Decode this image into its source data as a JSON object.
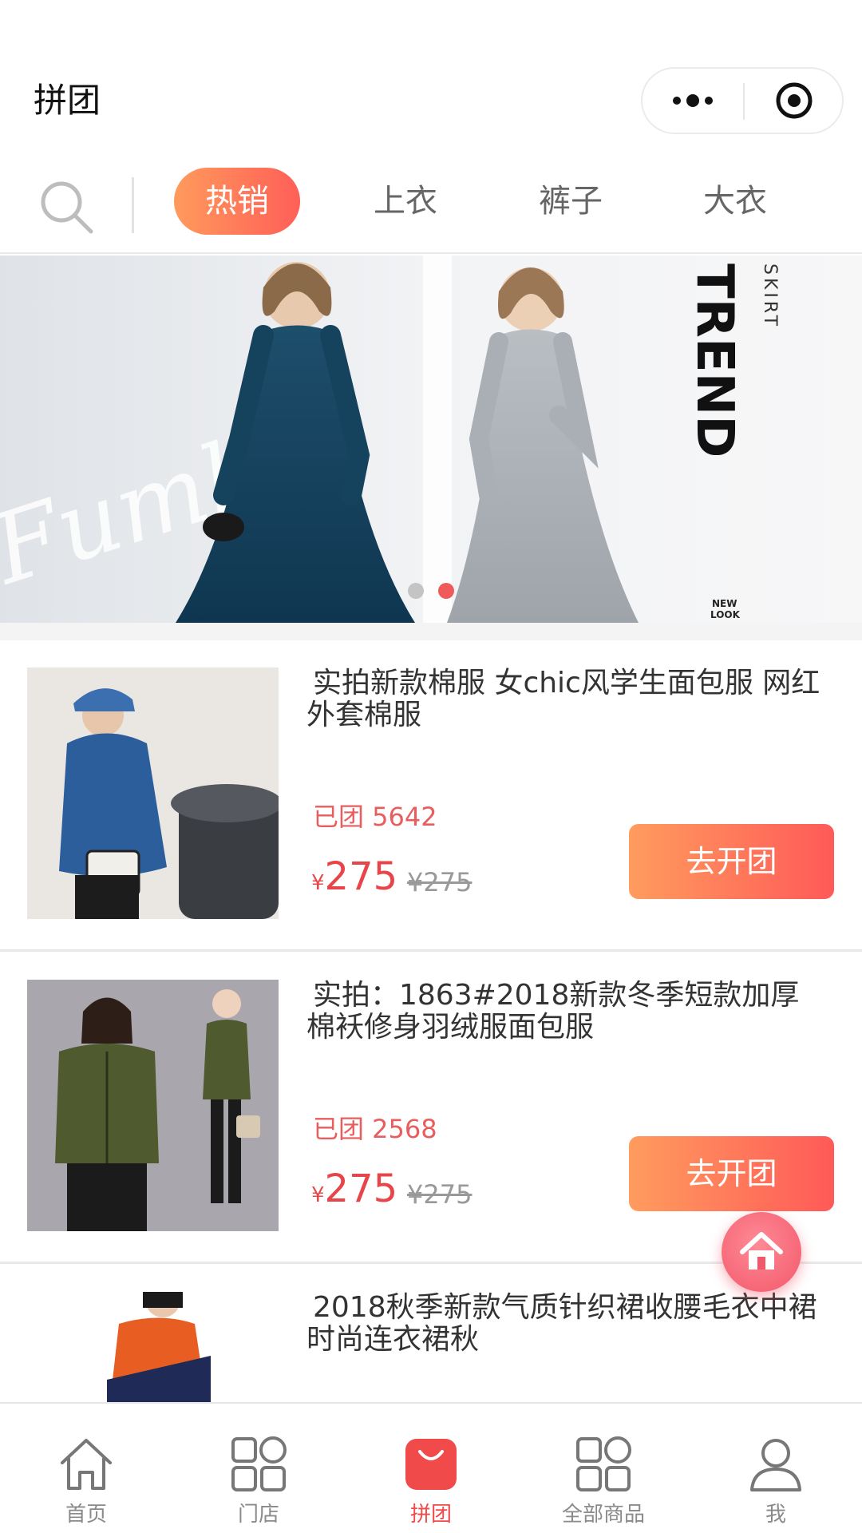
{
  "header": {
    "title": "拼团"
  },
  "capsule": {
    "more_icon": "more-dots-icon",
    "close_icon": "target-icon"
  },
  "catbar": {
    "search_icon": "search-icon",
    "tabs": [
      {
        "label": "热销",
        "active": true
      },
      {
        "label": "上衣",
        "active": false
      },
      {
        "label": "裤子",
        "active": false
      },
      {
        "label": "大衣",
        "active": false
      }
    ]
  },
  "banner": {
    "text_trend": "TREND",
    "text_skirt": "SKIRT",
    "text_new": "NEW",
    "text_look": "LOOK",
    "script_text": "Fumlg",
    "dots": [
      {
        "active": false
      },
      {
        "active": true
      }
    ]
  },
  "products": [
    {
      "title": "实拍新款棉服 女chic风学生面包服 网红外套棉服",
      "sold": "已团 5642",
      "currency": "¥",
      "price": "275",
      "orig_price": "¥275",
      "button": "去开团"
    },
    {
      "title": "实拍：1863#2018新款冬季短款加厚棉袄修身羽绒服面包服",
      "sold": "已团 2568",
      "currency": "¥",
      "price": "275",
      "orig_price": "¥275",
      "button": "去开团"
    },
    {
      "title": "2018秋季新款气质针织裙收腰毛衣中裙时尚连衣裙秋"
    }
  ],
  "float_home": {
    "icon": "home-icon"
  },
  "bottom_nav": [
    {
      "label": "首页",
      "icon": "home-icon",
      "active": false
    },
    {
      "label": "门店",
      "icon": "store-grid-icon",
      "active": false
    },
    {
      "label": "拼团",
      "icon": "shopping-bag-icon",
      "active": true
    },
    {
      "label": "全部商品",
      "icon": "all-products-grid-icon",
      "active": false
    },
    {
      "label": "我",
      "icon": "user-icon",
      "active": false
    }
  ],
  "colors": {
    "accent": "#f04a4a",
    "gradient_start": "#ff9a5c",
    "gradient_end": "#ff5f57"
  }
}
